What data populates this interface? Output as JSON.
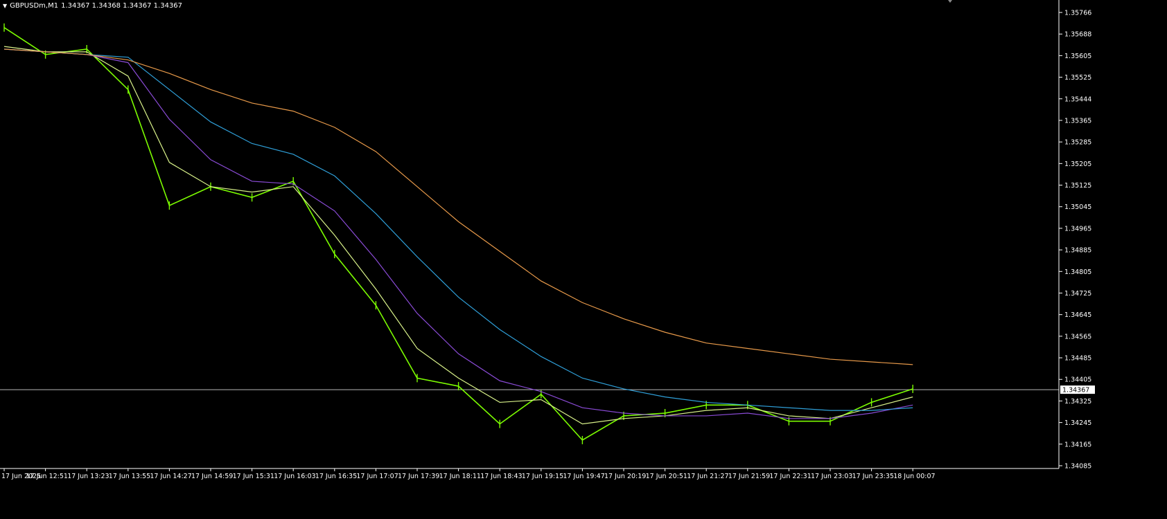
{
  "header": {
    "symbol": "GBPUSDm,M1",
    "ohlc": "1.34367 1.34368 1.34367 1.34367"
  },
  "colors": {
    "background": "#000000",
    "axis": "#ffffff",
    "candles": "#7cfc00",
    "ma_fast": "#d9f28a",
    "ma_purple": "#8a4bd6",
    "ma_blue": "#2f9fd8",
    "ma_orange": "#e89a4a",
    "price_line": "#b8b8b8"
  },
  "price_axis": {
    "labels": [
      "1.35766",
      "1.35688",
      "1.35605",
      "1.35525",
      "1.35444",
      "1.35365",
      "1.35285",
      "1.35205",
      "1.35125",
      "1.35045",
      "1.34965",
      "1.34885",
      "1.34805",
      "1.34725",
      "1.34645",
      "1.34565",
      "1.34485",
      "1.34405",
      "1.34325",
      "1.34245",
      "1.34165",
      "1.34085"
    ],
    "current_price": "1.34367"
  },
  "time_axis": {
    "labels": [
      "17 Jun 2025",
      "17 Jun 12:51",
      "17 Jun 13:23",
      "17 Jun 13:55",
      "17 Jun 14:27",
      "17 Jun 14:59",
      "17 Jun 15:31",
      "17 Jun 16:03",
      "17 Jun 16:35",
      "17 Jun 17:07",
      "17 Jun 17:39",
      "17 Jun 18:11",
      "17 Jun 18:43",
      "17 Jun 19:15",
      "17 Jun 19:47",
      "17 Jun 20:19",
      "17 Jun 20:51",
      "17 Jun 21:27",
      "17 Jun 21:59",
      "17 Jun 22:31",
      "17 Jun 23:03",
      "17 Jun 23:35",
      "18 Jun 00:07"
    ]
  },
  "chart_data": {
    "type": "line",
    "title": "GBPUSDm,M1",
    "ylim": [
      1.34085,
      1.35766
    ],
    "x": [
      "17 Jun 2025",
      "17 Jun 12:51",
      "17 Jun 13:23",
      "17 Jun 13:55",
      "17 Jun 14:27",
      "17 Jun 14:59",
      "17 Jun 15:31",
      "17 Jun 16:03",
      "17 Jun 16:35",
      "17 Jun 17:07",
      "17 Jun 17:39",
      "17 Jun 18:11",
      "17 Jun 18:43",
      "17 Jun 19:15",
      "17 Jun 19:47",
      "17 Jun 20:19",
      "17 Jun 20:51",
      "17 Jun 21:27",
      "17 Jun 21:59",
      "17 Jun 22:31",
      "17 Jun 23:03",
      "17 Jun 23:35",
      "18 Jun 00:07"
    ],
    "series": [
      {
        "values": [
          1.3571,
          1.3561,
          1.3563,
          1.3548,
          1.3505,
          1.3512,
          1.3508,
          1.3514,
          1.3487,
          1.3468,
          1.3441,
          1.3438,
          1.3424,
          1.3435,
          1.3418,
          1.3427,
          1.3428,
          1.3431,
          1.3431,
          1.3425,
          1.3425,
          1.3432,
          1.3437
        ]
      },
      {
        "values": [
          1.3564,
          1.3562,
          1.3562,
          1.3553,
          1.3521,
          1.3512,
          1.351,
          1.3512,
          1.3494,
          1.3474,
          1.3452,
          1.3441,
          1.3432,
          1.3433,
          1.3424,
          1.3426,
          1.3427,
          1.3429,
          1.343,
          1.3427,
          1.3426,
          1.343,
          1.3434
        ]
      },
      {
        "values": [
          1.3563,
          1.3562,
          1.3561,
          1.3558,
          1.3537,
          1.3522,
          1.3514,
          1.3513,
          1.3503,
          1.3485,
          1.3465,
          1.345,
          1.344,
          1.3436,
          1.343,
          1.3428,
          1.3427,
          1.3427,
          1.3428,
          1.3426,
          1.3426,
          1.3428,
          1.3431
        ]
      },
      {
        "values": [
          1.3563,
          1.3562,
          1.3561,
          1.356,
          1.3548,
          1.3536,
          1.3528,
          1.3524,
          1.3516,
          1.3502,
          1.3486,
          1.3471,
          1.3459,
          1.3449,
          1.3441,
          1.3437,
          1.3434,
          1.3432,
          1.3431,
          1.343,
          1.3429,
          1.3429,
          1.343
        ]
      },
      {
        "values": [
          1.3563,
          1.3562,
          1.3561,
          1.3559,
          1.3554,
          1.3548,
          1.3543,
          1.354,
          1.3534,
          1.3525,
          1.3512,
          1.3499,
          1.3488,
          1.3477,
          1.3469,
          1.3463,
          1.3458,
          1.3454,
          1.3452,
          1.345,
          1.3448,
          1.3447,
          1.3446
        ]
      }
    ]
  }
}
